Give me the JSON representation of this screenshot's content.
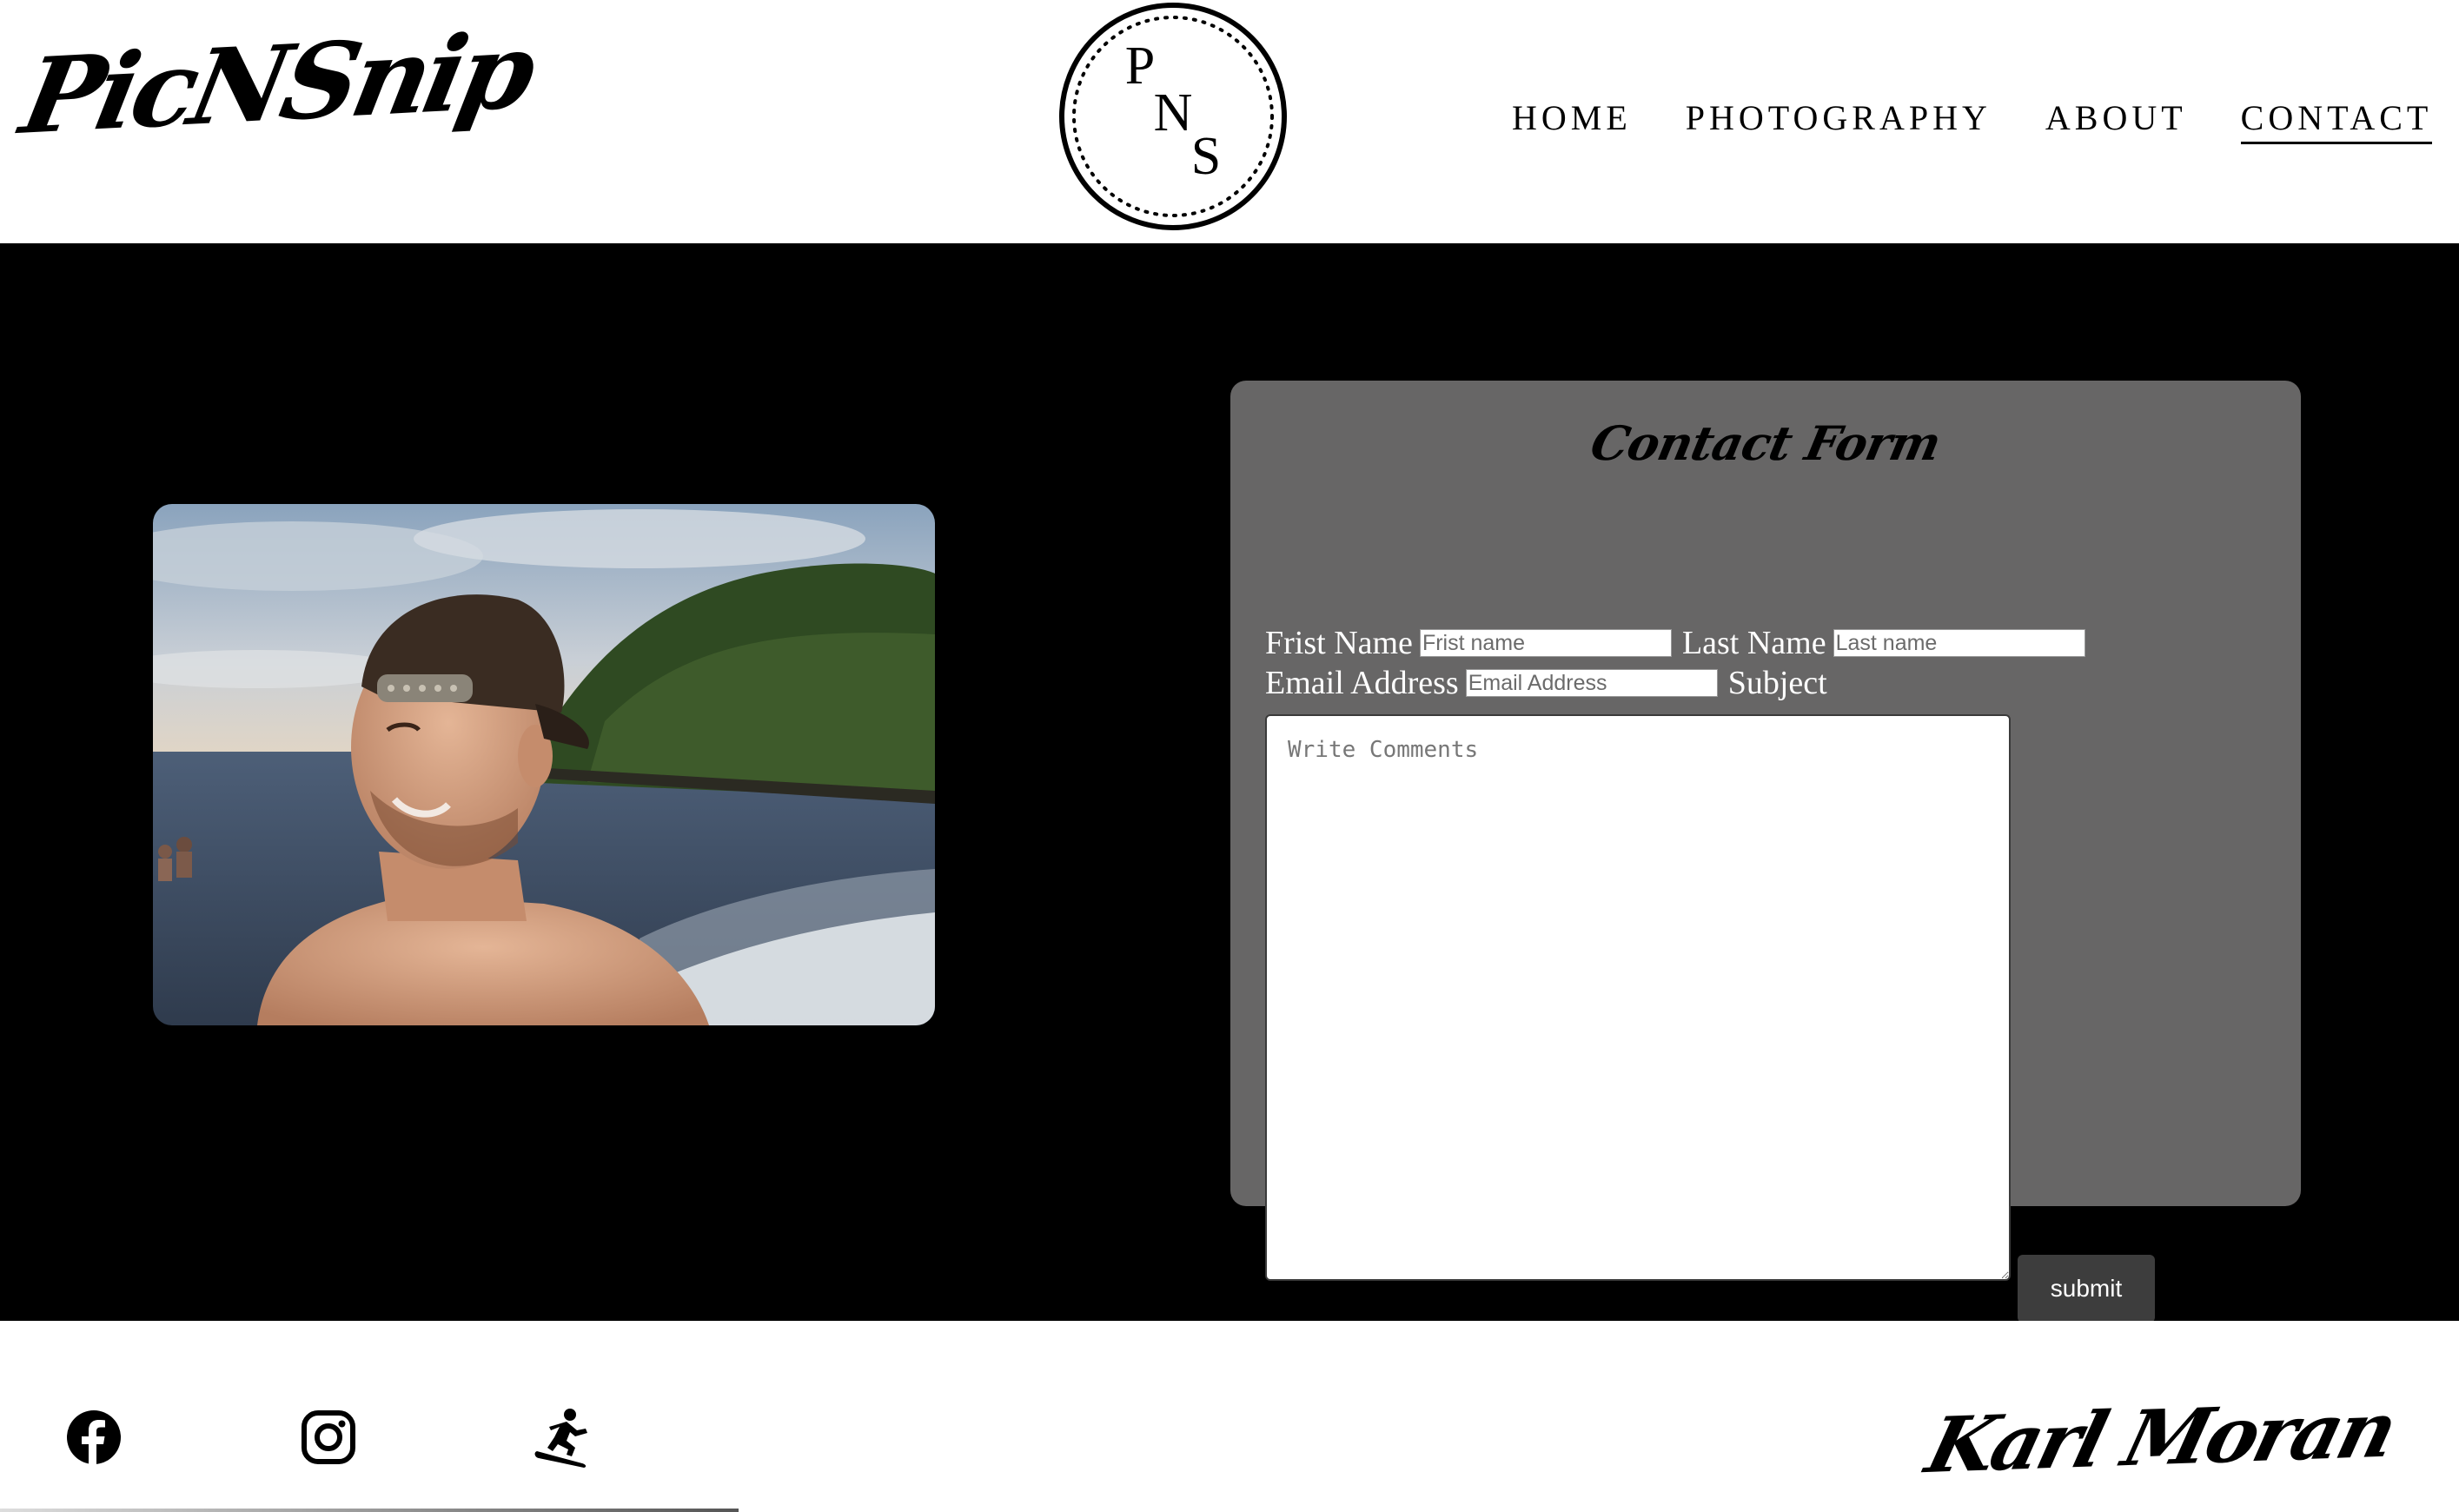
{
  "header": {
    "logo_text": "PicNSnip",
    "monogram": {
      "letters": [
        "P",
        "N",
        "S"
      ]
    },
    "nav": [
      {
        "label": "HOME",
        "active": false
      },
      {
        "label": "PHOTOGRAPHY",
        "active": false
      },
      {
        "label": "ABOUT",
        "active": false
      },
      {
        "label": "CONTACT",
        "active": true
      }
    ]
  },
  "contact_form": {
    "title": "Contact Form",
    "first_name_label": "Frist Name",
    "first_name_placeholder": "Frist name",
    "last_name_label": "Last Name",
    "last_name_placeholder": "Last name",
    "email_label": "Email Address",
    "email_placeholder": "Email Address",
    "subject_label": "Subject",
    "comments_placeholder": "Write Comments",
    "submit_label": "submit"
  },
  "footer": {
    "social_icons": [
      "facebook-icon",
      "instagram-icon",
      "snowboarder-icon"
    ],
    "signature": "Karl Moran"
  },
  "colors": {
    "main_bg": "#000000",
    "form_panel": "#676666",
    "submit_bg": "#3d3d3d"
  }
}
